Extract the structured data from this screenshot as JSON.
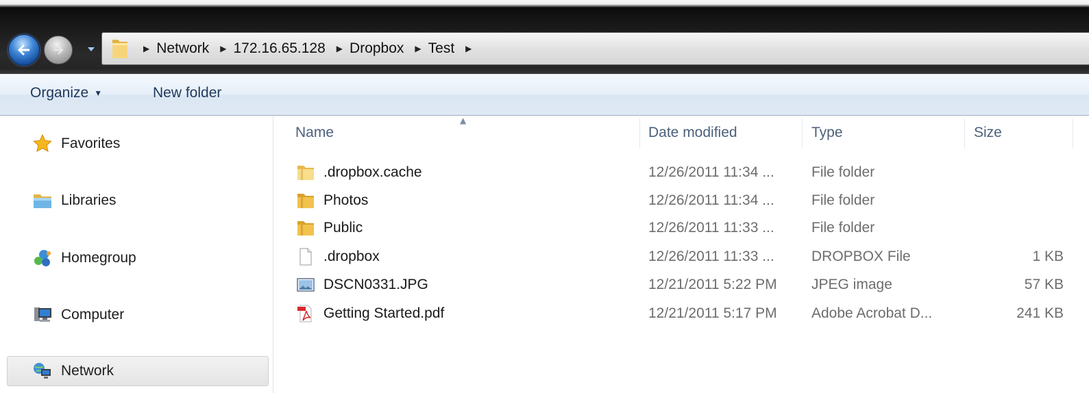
{
  "address_bar": {
    "crumbs": [
      "Network",
      "172.16.65.128",
      "Dropbox",
      "Test"
    ]
  },
  "command_bar": {
    "organize_label": "Organize",
    "new_folder_label": "New folder"
  },
  "nav_pane": {
    "items": [
      {
        "label": "Favorites",
        "icon": "star-icon"
      },
      {
        "label": "Libraries",
        "icon": "libraries-icon"
      },
      {
        "label": "Homegroup",
        "icon": "homegroup-icon"
      },
      {
        "label": "Computer",
        "icon": "computer-icon"
      },
      {
        "label": "Network",
        "icon": "network-icon",
        "selected": true
      }
    ]
  },
  "file_list": {
    "columns": {
      "name": "Name",
      "date": "Date modified",
      "type": "Type",
      "size": "Size"
    },
    "sort": {
      "column": "Name",
      "direction": "ascending"
    },
    "rows": [
      {
        "name": ".dropbox.cache",
        "date": "12/26/2011 11:34 ...",
        "type": "File folder",
        "size": "",
        "icon": "folder-icon"
      },
      {
        "name": "Photos",
        "date": "12/26/2011 11:34 ...",
        "type": "File folder",
        "size": "",
        "icon": "folder-icon"
      },
      {
        "name": "Public",
        "date": "12/26/2011 11:33 ...",
        "type": "File folder",
        "size": "",
        "icon": "folder-icon"
      },
      {
        "name": ".dropbox",
        "date": "12/26/2011 11:33 ...",
        "type": "DROPBOX File",
        "size": "1 KB",
        "icon": "blank-file-icon"
      },
      {
        "name": "DSCN0331.JPG",
        "date": "12/21/2011 5:22 PM",
        "type": "JPEG image",
        "size": "57 KB",
        "icon": "image-file-icon"
      },
      {
        "name": "Getting Started.pdf",
        "date": "12/21/2011 5:17 PM",
        "type": "Adobe Acrobat D...",
        "size": "241 KB",
        "icon": "pdf-file-icon"
      }
    ]
  }
}
